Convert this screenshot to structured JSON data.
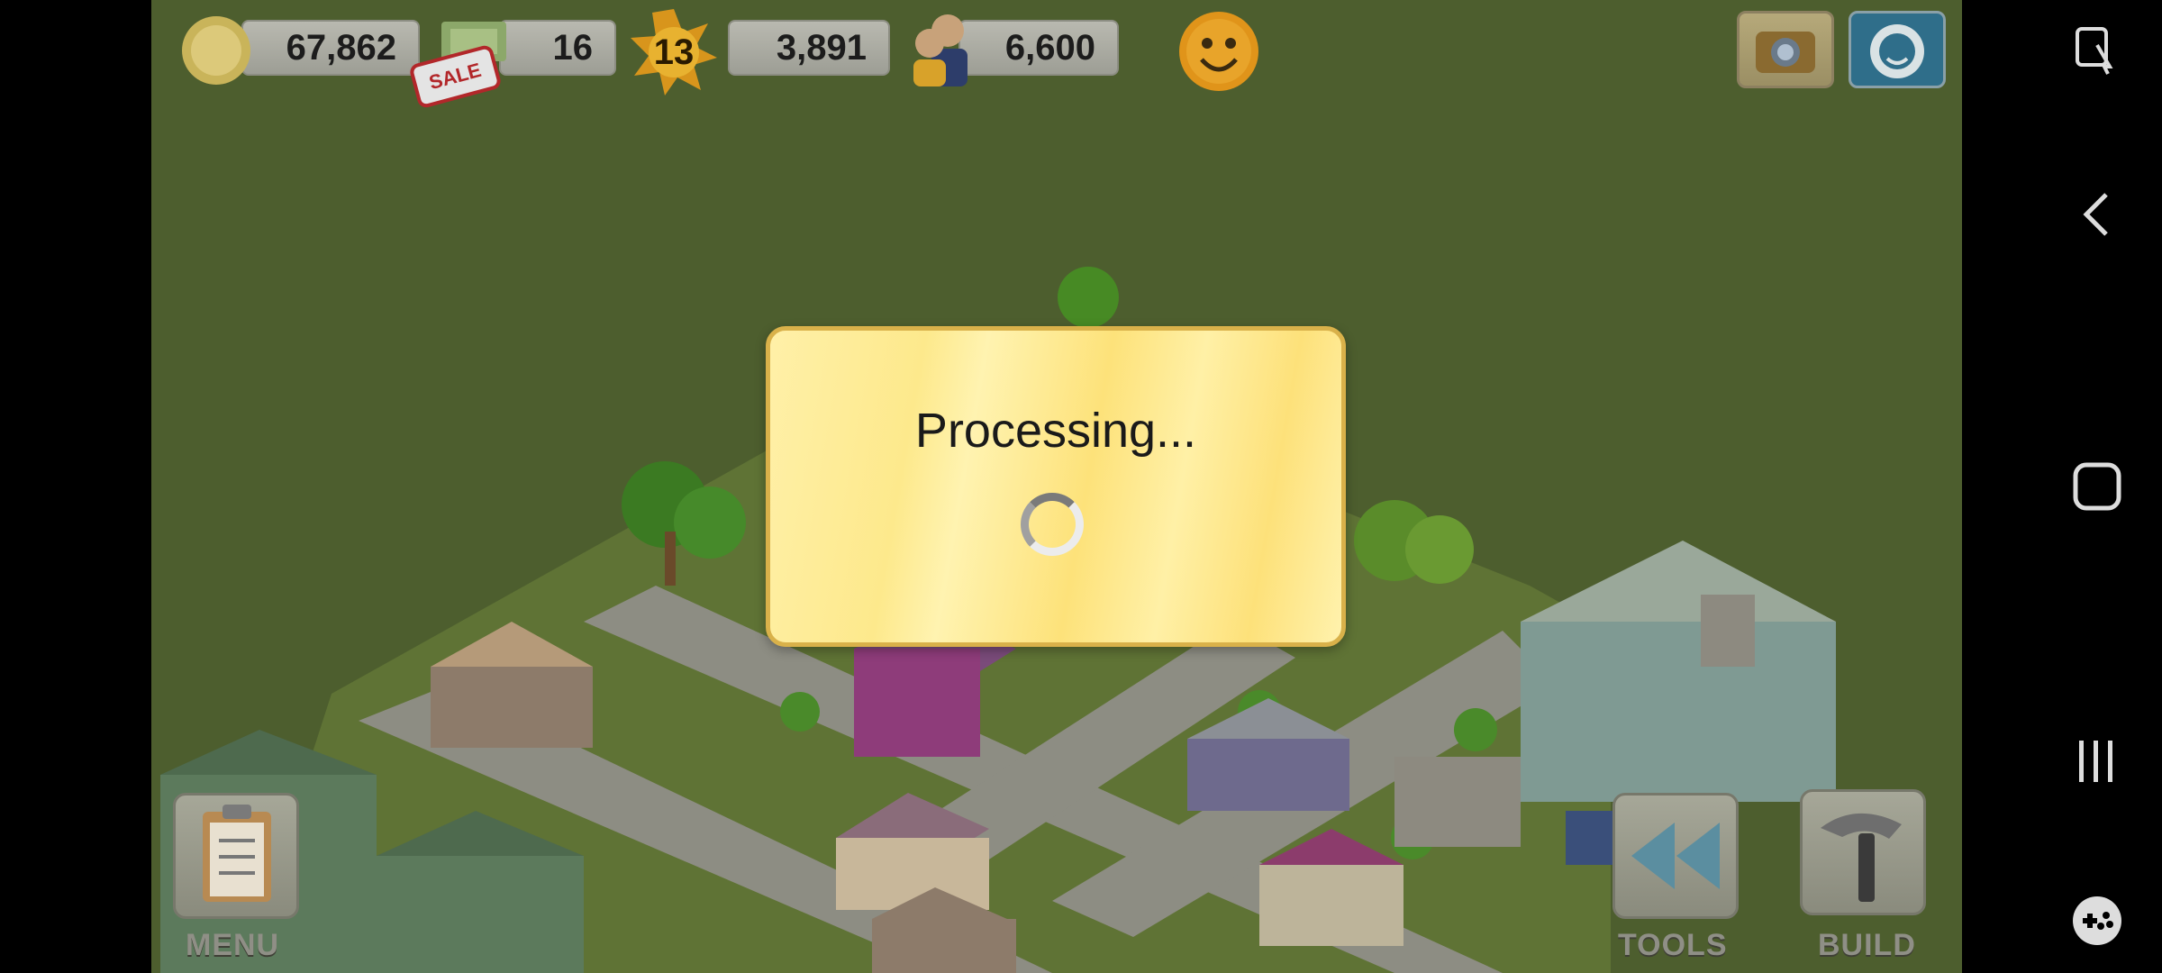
{
  "hud": {
    "coins": "67,862",
    "cash": "16",
    "sale_label": "SALE",
    "level": "13",
    "xp": "3,891",
    "population": "6,600"
  },
  "dialog": {
    "title": "Processing..."
  },
  "tools": {
    "menu_label": "MENU",
    "tools_label": "TOOLS",
    "build_label": "BUILD"
  },
  "colors": {
    "background": "#4d5e2e",
    "dialog": "#fde98c",
    "button": "#9d9e95"
  }
}
